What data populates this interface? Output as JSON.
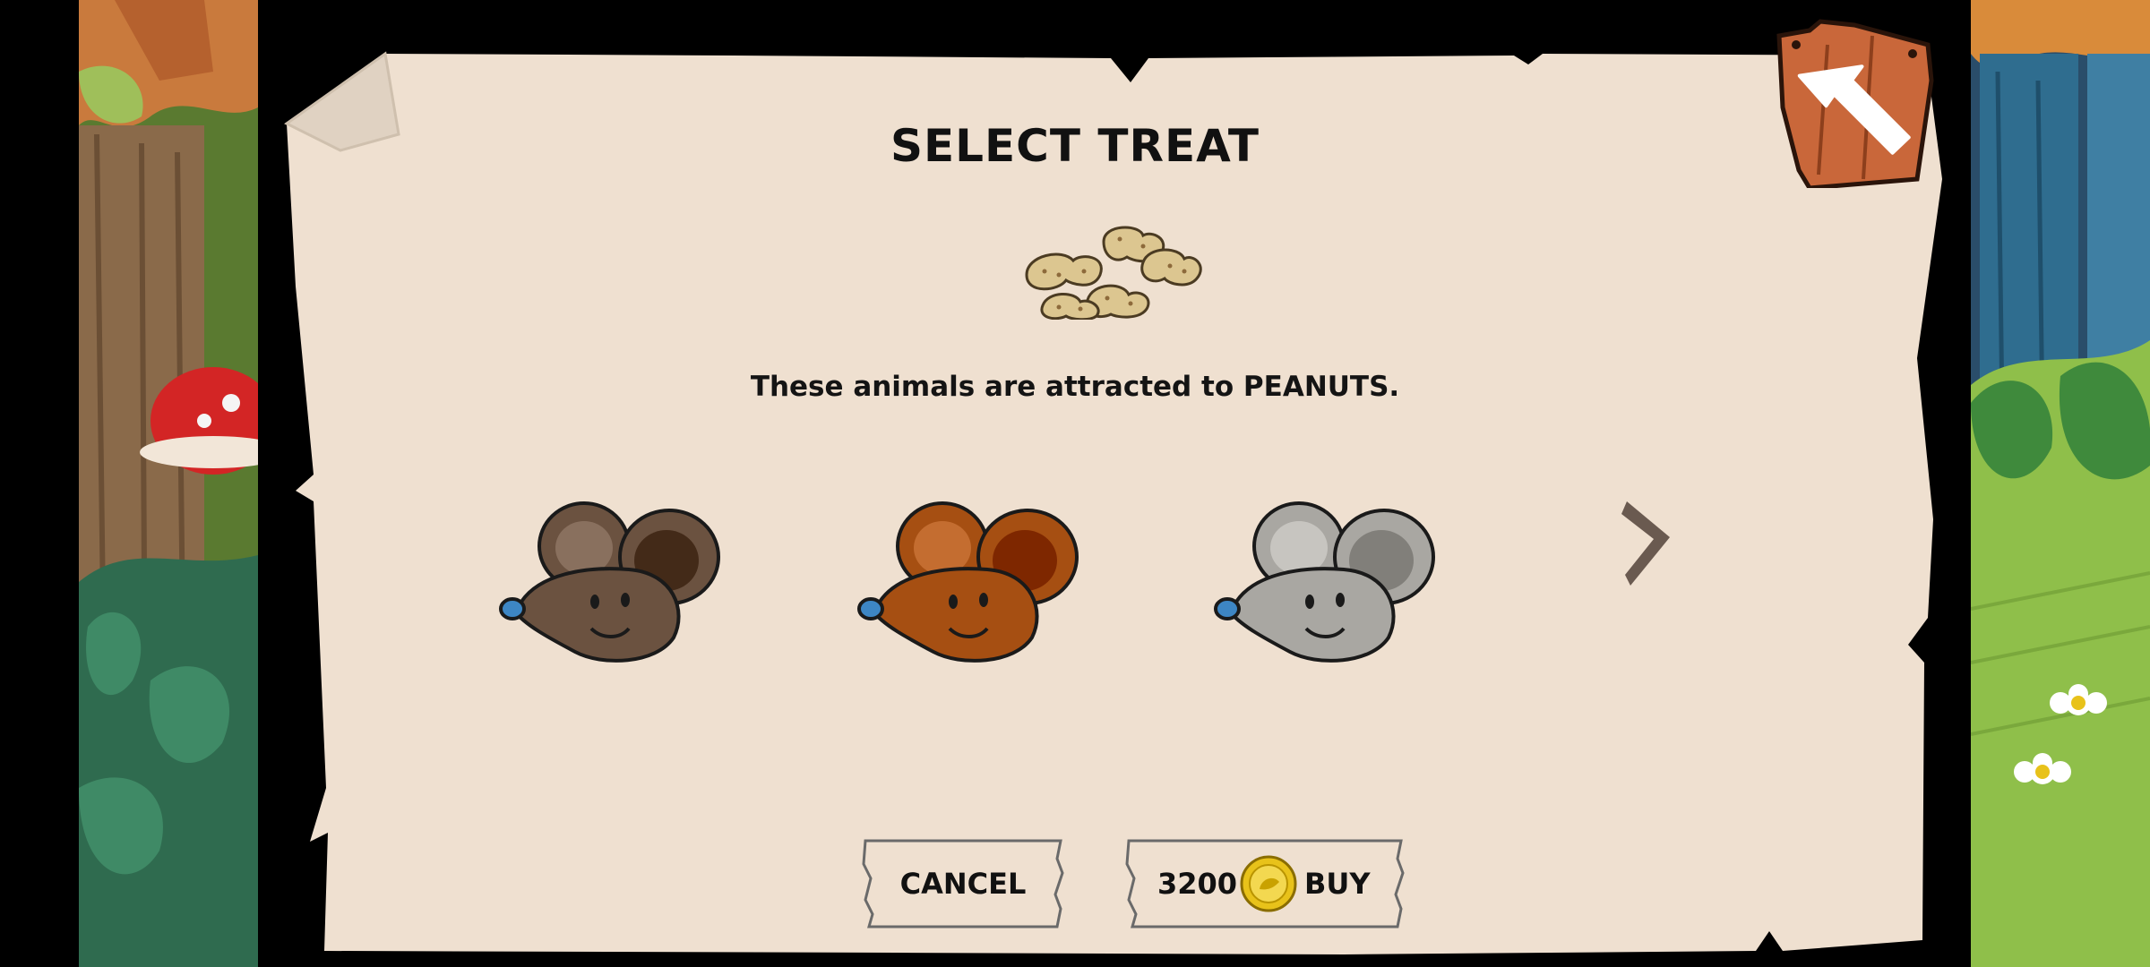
{
  "dialog": {
    "title": "SELECT TREAT",
    "treat_icon": "peanuts-icon",
    "description": "These animals are attracted to PEANUTS."
  },
  "animals": [
    {
      "name": "brown-mouse",
      "icon": "mouse-head-icon",
      "fur_color": "#6b5240"
    },
    {
      "name": "orange-mouse",
      "icon": "mouse-head-icon",
      "fur_color": "#a64f12"
    },
    {
      "name": "grey-mouse",
      "icon": "mouse-head-icon",
      "fur_color": "#a9a7a2"
    }
  ],
  "navigation": {
    "next_icon": "chevron-right-icon",
    "back_icon": "back-arrow-icon"
  },
  "buttons": {
    "cancel_label": "CANCEL",
    "price": "3200",
    "currency_icon": "gold-coin-icon",
    "buy_label": "BUY"
  },
  "colors": {
    "paper": "#efe0d0",
    "frame": "#000000",
    "coin": "#e8c21a",
    "wood_sign": "#c9673a"
  }
}
